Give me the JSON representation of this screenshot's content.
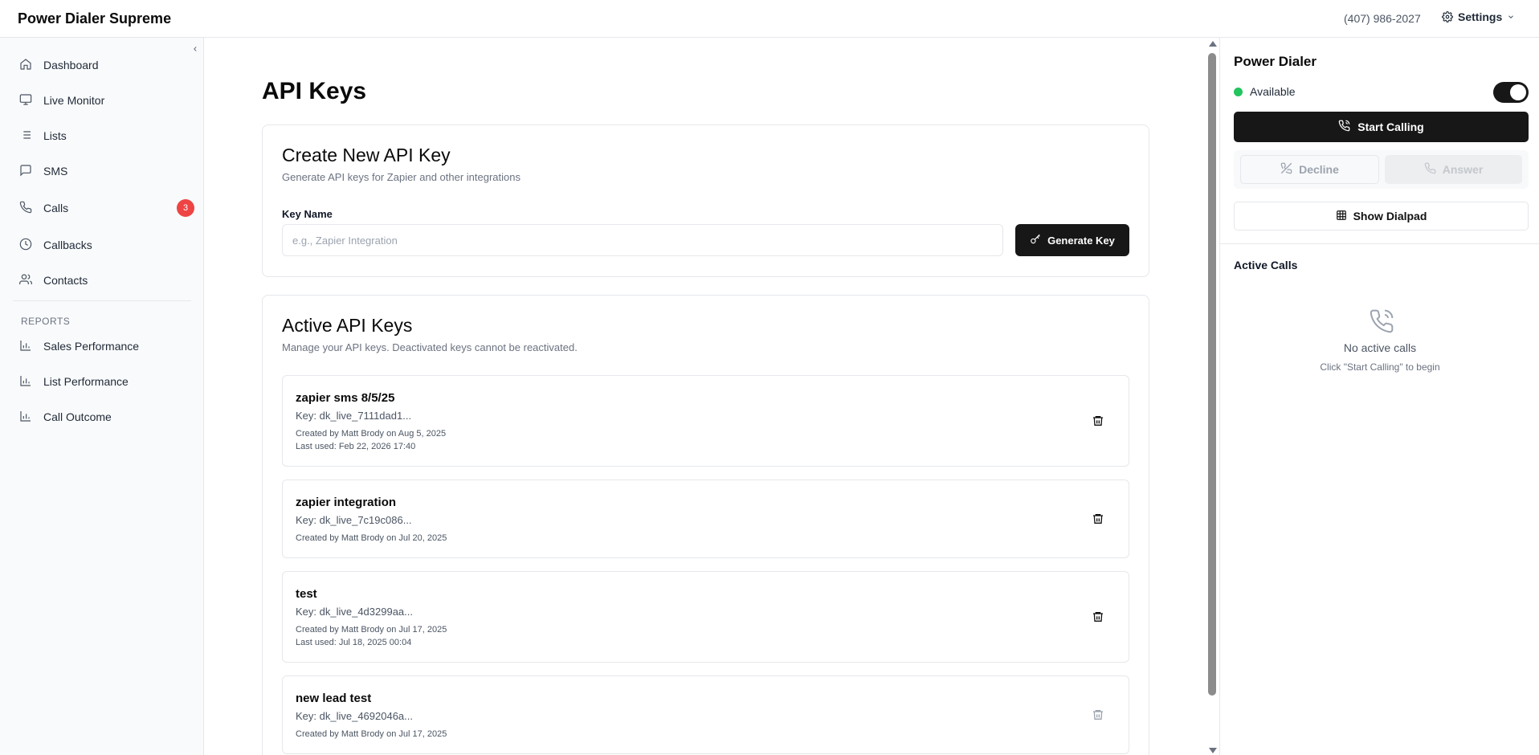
{
  "app": {
    "brand": "Power Dialer Supreme"
  },
  "header": {
    "phone": "(407) 986-2027",
    "settings_label": "Settings"
  },
  "sidebar": {
    "items": [
      {
        "label": "Dashboard",
        "icon": "home-icon"
      },
      {
        "label": "Live Monitor",
        "icon": "monitor-icon"
      },
      {
        "label": "Lists",
        "icon": "list-icon"
      },
      {
        "label": "SMS",
        "icon": "message-icon"
      },
      {
        "label": "Calls",
        "icon": "phone-icon",
        "badge": "3"
      },
      {
        "label": "Callbacks",
        "icon": "clock-icon"
      },
      {
        "label": "Contacts",
        "icon": "users-icon"
      }
    ],
    "reports_label": "REPORTS",
    "reports": [
      {
        "label": "Sales Performance",
        "icon": "bar-chart-icon"
      },
      {
        "label": "List Performance",
        "icon": "bar-chart-icon"
      },
      {
        "label": "Call Outcome",
        "icon": "bar-chart-icon"
      }
    ]
  },
  "main": {
    "title": "API Keys",
    "create_card": {
      "title": "Create New API Key",
      "subtitle": "Generate API keys for Zapier and other integrations",
      "field_label": "Key Name",
      "placeholder": "e.g., Zapier Integration",
      "value": "",
      "button_label": "Generate Key"
    },
    "active_card": {
      "title": "Active API Keys",
      "subtitle": "Manage your API keys. Deactivated keys cannot be reactivated.",
      "keys": [
        {
          "name": "zapier sms 8/5/25",
          "key": "Key: dk_live_7111dad1...",
          "created": "Created by Matt Brody on Aug 5, 2025",
          "last_used": "Last used: Feb 22, 2026 17:40"
        },
        {
          "name": "zapier integration",
          "key": "Key: dk_live_7c19c086...",
          "created": "Created by Matt Brody on Jul 20, 2025",
          "last_used": ""
        },
        {
          "name": "test",
          "key": "Key: dk_live_4d3299aa...",
          "created": "Created by Matt Brody on Jul 17, 2025",
          "last_used": "Last used: Jul 18, 2025 00:04"
        },
        {
          "name": "new lead test",
          "key": "Key: dk_live_4692046a...",
          "created": "Created by Matt Brody on Jul 17, 2025",
          "last_used": ""
        }
      ]
    }
  },
  "right_panel": {
    "title": "Power Dialer",
    "status": "Available",
    "status_color": "#22c55e",
    "available_toggle": true,
    "start_label": "Start Calling",
    "decline_label": "Decline",
    "answer_label": "Answer",
    "dialpad_label": "Show Dialpad",
    "active_calls_title": "Active Calls",
    "empty_title": "No active calls",
    "empty_sub": "Click \"Start Calling\" to begin"
  }
}
